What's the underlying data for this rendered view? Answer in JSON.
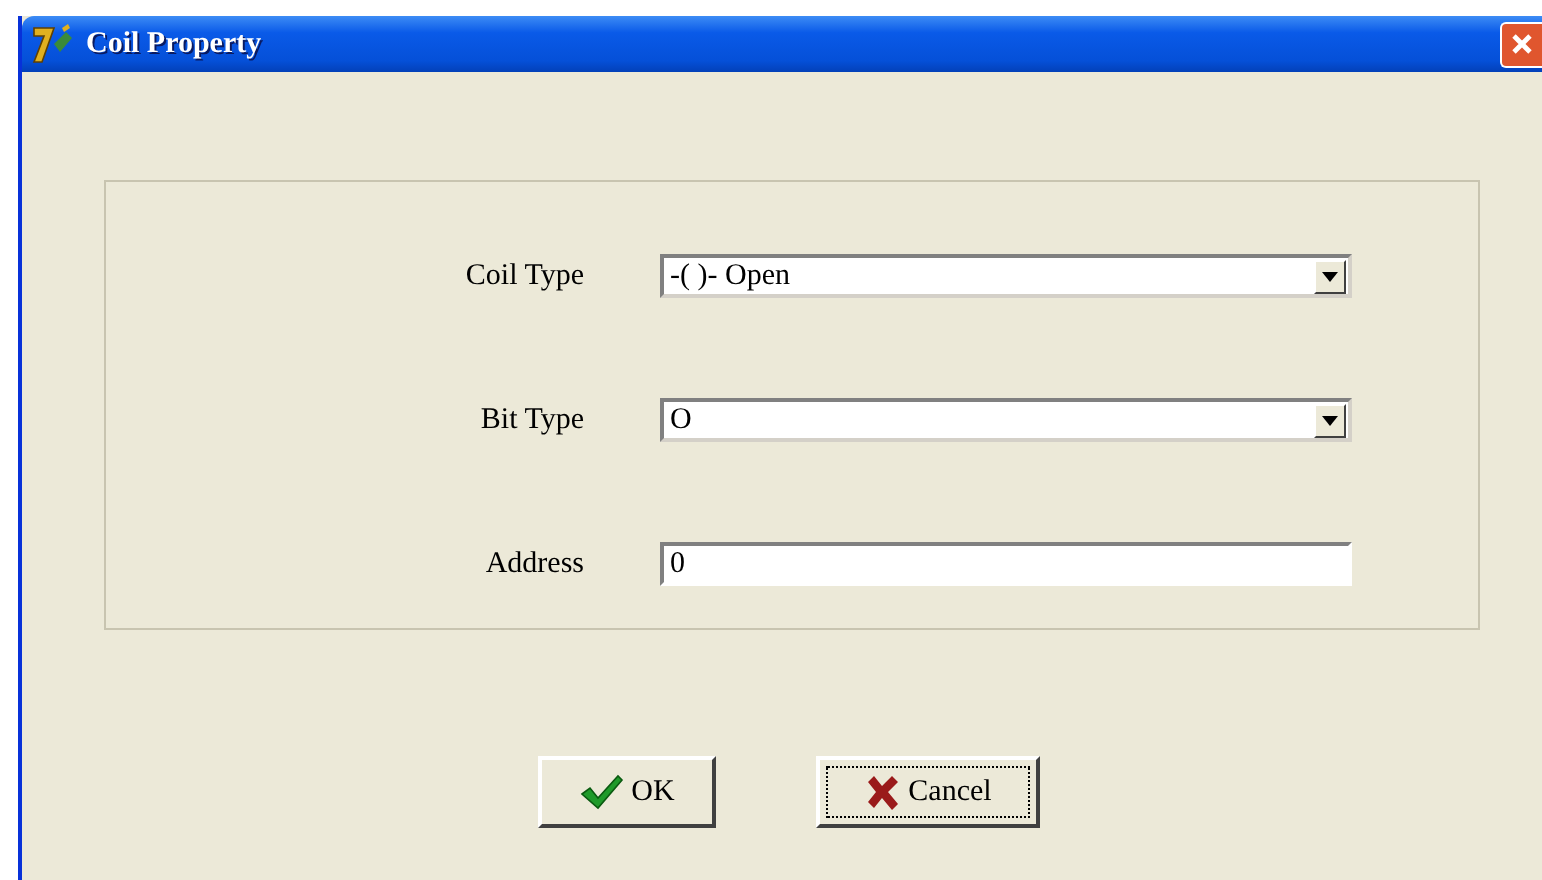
{
  "window": {
    "title": "Coil Property"
  },
  "fields": [
    {
      "kind": "dropdown",
      "label": "Coil Type",
      "value": "-( )- Open"
    },
    {
      "kind": "dropdown",
      "label": "Bit Type",
      "value": "O"
    },
    {
      "kind": "text",
      "label": "Address",
      "value": "0"
    }
  ],
  "buttons": [
    {
      "kind": "ok",
      "label": "OK",
      "focused": false
    },
    {
      "kind": "cancel",
      "label": "Cancel",
      "focused": true
    }
  ]
}
